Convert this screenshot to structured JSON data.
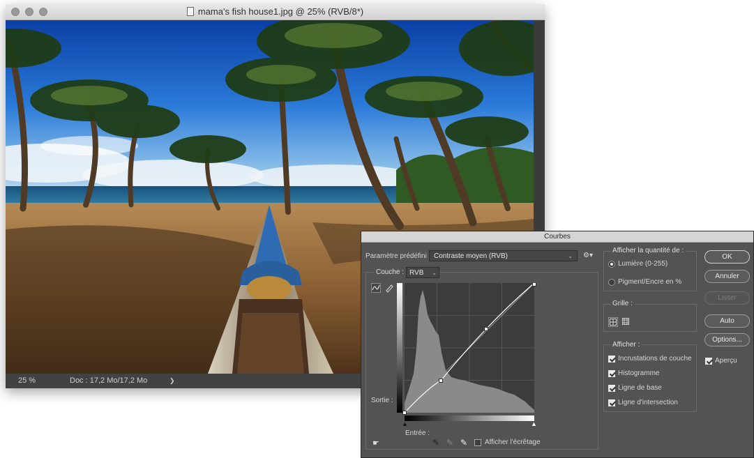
{
  "window": {
    "title": "mama's fish house1.jpg @ 25% (RVB/8*)"
  },
  "status": {
    "zoom": "25 %",
    "doc": "Doc : 17,2 Mo/17,2 Mo",
    "arrow": "❯"
  },
  "dialog": {
    "title": "Courbes",
    "preset_label": "Paramètre prédéfini :",
    "preset_value": "Contraste moyen (RVB)",
    "channel_label": "Couche :",
    "channel_value": "RVB",
    "output_label": "Sortie :",
    "input_label": "Entrée :",
    "clipping_label": "Afficher l'écrêtage",
    "amount": {
      "title": "Afficher la quantité de :",
      "light": "Lumière (0-255)",
      "pigment": "Pigment/Encre en %",
      "selected": "light"
    },
    "grid": {
      "title": "Grille :"
    },
    "show": {
      "title": "Afficher :",
      "items": [
        {
          "label": "Incrustations de couche",
          "checked": true
        },
        {
          "label": "Histogramme",
          "checked": true
        },
        {
          "label": "Ligne de base",
          "checked": true
        },
        {
          "label": "Ligne d'intersection",
          "checked": true
        }
      ]
    },
    "buttons": {
      "ok": "OK",
      "cancel": "Annuler",
      "smooth": "Lisser",
      "auto": "Auto",
      "options": "Options..."
    },
    "preview": {
      "label": "Aperçu",
      "checked": true
    }
  }
}
